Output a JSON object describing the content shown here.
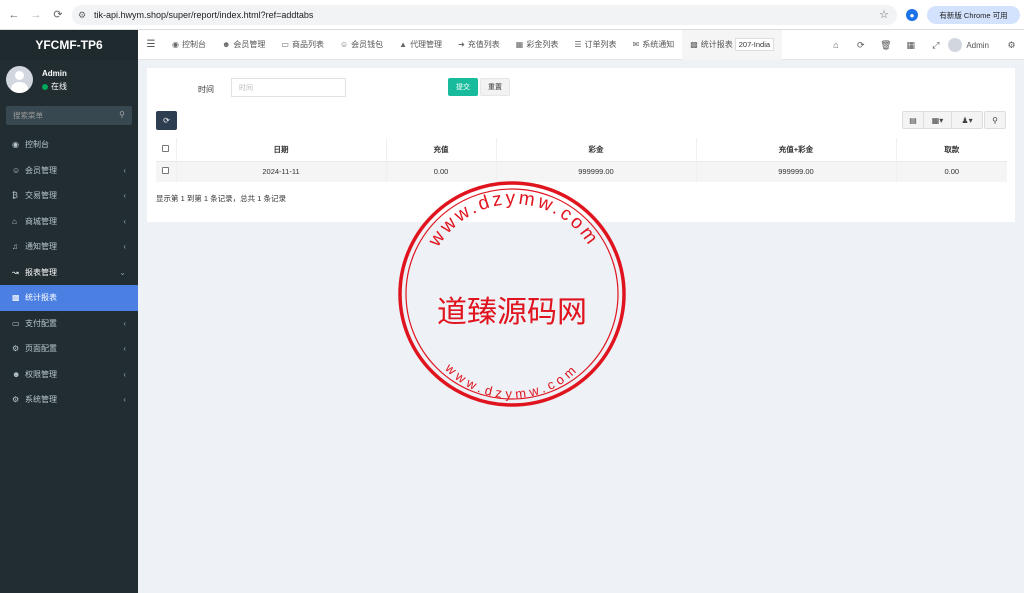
{
  "browser": {
    "url": "tik-api.hwym.shop/super/report/index.html?ref=addtabs",
    "update_chip": "有新版 Chrome 可用"
  },
  "sidebar": {
    "brand": "YFCMF-TP6",
    "user": {
      "name": "Admin",
      "status": "在线"
    },
    "search_placeholder": "搜索菜单",
    "items": [
      {
        "label": "控制台",
        "icon": "dashboard-icon",
        "has_arrow": false
      },
      {
        "label": "会员管理",
        "icon": "user-circle-icon",
        "has_arrow": true
      },
      {
        "label": "交易管理",
        "icon": "bitcoin-icon",
        "has_arrow": true
      },
      {
        "label": "商城管理",
        "icon": "home-icon",
        "has_arrow": true
      },
      {
        "label": "通知管理",
        "icon": "bell-icon",
        "has_arrow": true
      },
      {
        "label": "报表管理",
        "icon": "line-chart-icon",
        "has_arrow": true,
        "open": true
      },
      {
        "label": "统计报表",
        "icon": "bar-chart-icon",
        "has_arrow": false,
        "active": true
      },
      {
        "label": "支付配置",
        "icon": "credit-card-icon",
        "has_arrow": true
      },
      {
        "label": "页面配置",
        "icon": "gear-icon",
        "has_arrow": true
      },
      {
        "label": "权限管理",
        "icon": "users-icon",
        "has_arrow": true
      },
      {
        "label": "系统管理",
        "icon": "gears-icon",
        "has_arrow": true
      }
    ]
  },
  "topnav": {
    "tabs": [
      {
        "label": "控制台",
        "icon": "dashboard-icon"
      },
      {
        "label": "会员管理",
        "icon": "user-icon"
      },
      {
        "label": "商品列表",
        "icon": "monitor-icon"
      },
      {
        "label": "会员钱包",
        "icon": "wallet-icon"
      },
      {
        "label": "代理管理",
        "icon": "sitemap-icon"
      },
      {
        "label": "充值列表",
        "icon": "sign-in-icon"
      },
      {
        "label": "彩金列表",
        "icon": "gift-icon"
      },
      {
        "label": "订单列表",
        "icon": "list-icon"
      },
      {
        "label": "系统通知",
        "icon": "comments-icon"
      },
      {
        "label": "统计报表",
        "icon": "bar-chart-icon",
        "selected": true
      }
    ],
    "region_chip": "207-India",
    "admin_label": "Admin"
  },
  "filter": {
    "time_label": "时间",
    "time_placeholder": "时间",
    "submit_label": "提交",
    "reset_label": "重置"
  },
  "table": {
    "columns": [
      "日期",
      "充值",
      "彩金",
      "充值+彩金",
      "取款"
    ],
    "rows": [
      [
        "2024-11-11",
        "0.00",
        "999999.00",
        "999999.00",
        "0.00"
      ]
    ],
    "summary": "显示第 1 到第 1 条记录，总共 1 条记录"
  },
  "watermark": {
    "top_arc": "www.dzymw.com",
    "center": "道臻源码网",
    "bottom_arc": "www.dzymw.com",
    "color": "#e0141e"
  },
  "colors": {
    "sidebar_bg": "#222d32",
    "sidebar_active": "#4b80e2",
    "submit_btn": "#18bc9c",
    "refresh_btn": "#2c3e50"
  }
}
